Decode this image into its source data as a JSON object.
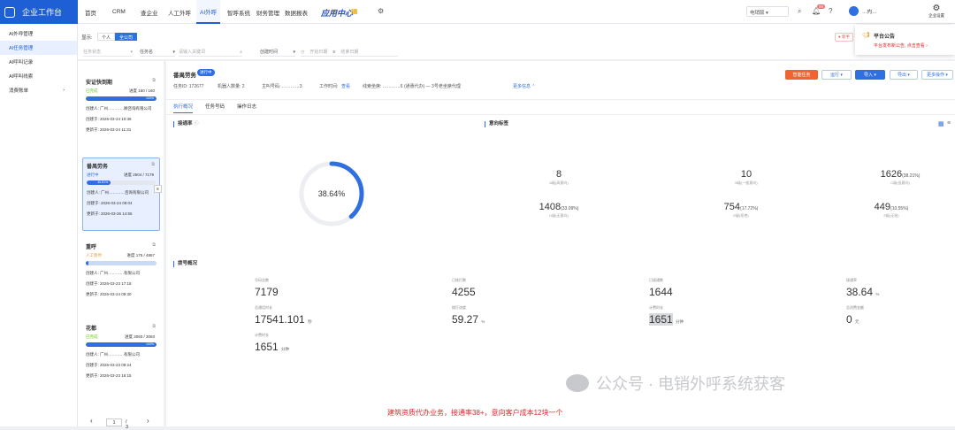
{
  "app": {
    "title": "企业工作台"
  },
  "topnav": {
    "items": [
      "首页",
      "CRM",
      "查企业",
      "人工外呼",
      "AI外呼",
      "智呼系统",
      "财务管理",
      "数据报表"
    ],
    "active_index": 4,
    "brand": "应用中心",
    "brand_suffix": "▦",
    "env_select": "电销版",
    "notif_count": "99",
    "user_name": "…内…",
    "enterprise_settings": "企业设置"
  },
  "sidebar": {
    "items": [
      "AI外呼管理",
      "AI任务管理",
      "AI呼叫记录",
      "AI呼叫线索",
      "消费账单"
    ],
    "active_index": 1
  },
  "filters": {
    "display_label": "显示:",
    "segment": [
      "个人",
      "全公司"
    ],
    "active_segment": 1,
    "task_status_placeholder": "任务状态",
    "task_name_label": "任务名",
    "task_name_placeholder": "请输入关键词",
    "created_time_label": "创建时间",
    "start_date": "开始日期",
    "end_date": "结束日期"
  },
  "notice": {
    "title": "平台公告",
    "text": "平台发布新公告, 点击查看 ›"
  },
  "tasks": [
    {
      "name": "安证快到期",
      "status": "已完成",
      "progress_text": "进度 160 / 160",
      "progress": 1.0,
      "progress_label": "100%",
      "creator": "创建人:  广州…………顾咨询有限公司",
      "created": "创建于:  2026-03-24 10:36",
      "updated": "更新于:  2026-03-24 11:31"
    },
    {
      "name": "番禺劳务",
      "status": "进行中",
      "progress_text": "进度 2504 / 7179",
      "progress": 0.3487,
      "progress_label": "40.81%",
      "creator": "创建人:  广州…………咨询有限公司",
      "created": "创建于:  2026-03-24 09:04",
      "updated": "更新于:  2026-03-26 14:55"
    },
    {
      "name": "重呼",
      "status": "人工暂停",
      "progress_text": "进度 175 / 4867",
      "progress": 0.036,
      "progress_label": "",
      "creator": "创建人:  广州…………有限公司",
      "created": "创建于:  2026-03-23 17:18",
      "updated": "更新于:  2026-03-24 09:30"
    },
    {
      "name": "花都",
      "status": "已完成",
      "progress_text": "进度 3093 / 3093",
      "progress": 1.0,
      "progress_label": "100%",
      "creator": "创建人:  广州…………有限公司",
      "created": "创建于:  2026-03-23 09:24",
      "updated": "更新于:  2026-03-23 16:15"
    }
  ],
  "pager": {
    "prev": "‹",
    "page": "1",
    "total": "/ 3",
    "next": "›"
  },
  "detail": {
    "title": "番禺劳务",
    "status_tag": "进行中",
    "info": {
      "task_id": "任务ID:  172677",
      "robot_count": "机器人数量:  2",
      "caller": "主叫号码:  …………3",
      "work_time_label": "工作时间:",
      "work_time_link": "查看",
      "scene": "线索坐席:  …………6 (通惠代办) — 3号老坐席代理",
      "more": "更多信息 ⌃"
    },
    "buttons": {
      "smart_task": "智能任务",
      "run": "运行 ▾",
      "import": "导入 ▾",
      "export": "导出 ▾",
      "more_ops": "更多操作 ▾"
    },
    "tabs": [
      "执行概况",
      "任务号码",
      "操作日志"
    ],
    "active_tab": 0,
    "connect_title": "接通率",
    "connect_rate": 0.3864,
    "connect_rate_label": "38.64%",
    "intent_title": "意向标签",
    "intent": [
      {
        "value": "8",
        "suffix": "",
        "label": "A级(高意向)"
      },
      {
        "value": "10",
        "suffix": "",
        "label": "B级(一般意向)"
      },
      {
        "value": "1626",
        "suffix": "(38.21%)",
        "label": "C级(低意向)"
      },
      {
        "value": "1408",
        "suffix": "(33.09%)",
        "label": "D级(无意向)"
      },
      {
        "value": "754",
        "suffix": "(17.72%)",
        "label": "E级(拒绝)"
      },
      {
        "value": "449",
        "suffix": "(10.55%)",
        "label": "F级(无效)"
      }
    ],
    "overview_title": "拨号概况",
    "overview": [
      {
        "label": "号码总数",
        "value": "7179",
        "unit": ""
      },
      {
        "label": "已拨打数",
        "value": "4255",
        "unit": ""
      },
      {
        "label": "已接通数",
        "value": "1644",
        "unit": ""
      },
      {
        "label": "接通率",
        "value": "38.64",
        "unit": "%"
      },
      {
        "label": "总通话时长",
        "value": "17541.101",
        "unit": "秒"
      },
      {
        "label": "拨打进度",
        "value": "59.27",
        "unit": "%"
      },
      {
        "label": "计费时长",
        "value": "1651",
        "unit": "分钟"
      },
      {
        "label": "总消费金额",
        "value": "0",
        "unit": "元"
      },
      {
        "label": "计费时长",
        "value": "1651",
        "unit": "分钟"
      }
    ]
  },
  "watermark": "公众号 · 电销外呼系统获客",
  "caption": "建筑资质代办业务，接通率38+，意向客户成本12块一个"
}
